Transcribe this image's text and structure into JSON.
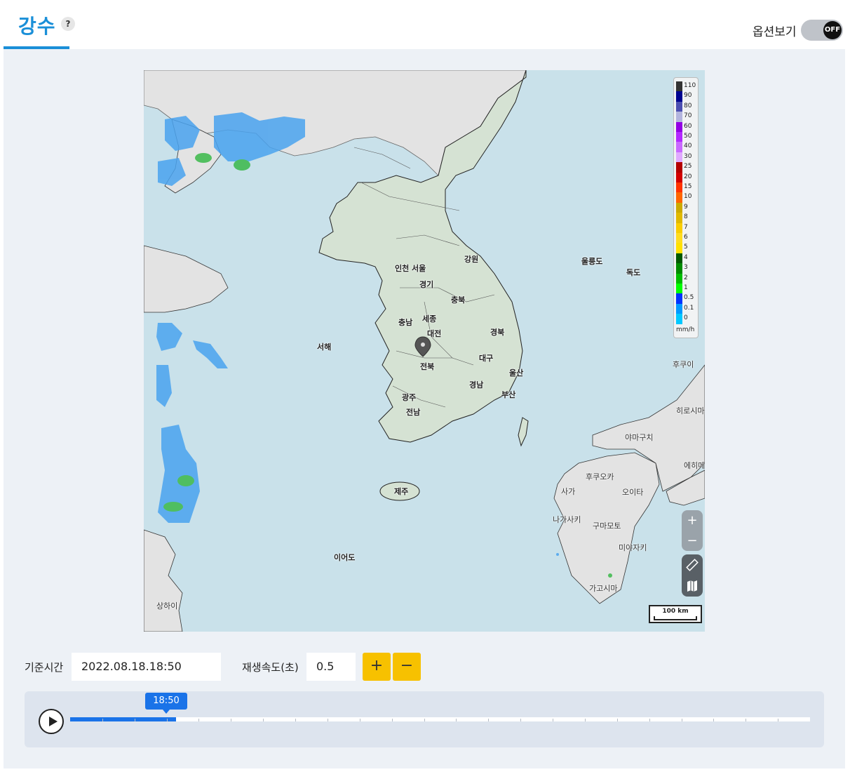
{
  "header": {
    "title": "강수",
    "help_symbol": "?",
    "option_label": "옵션보기",
    "toggle_state": "OFF"
  },
  "map": {
    "places": {
      "incheon": "인천",
      "seoul": "서울",
      "gyeonggi": "경기",
      "gangwon": "강원",
      "ulleungdo": "울릉도",
      "dokdo": "독도",
      "chungbuk": "충북",
      "sejong": "세종",
      "chungnam": "충남",
      "daejeon": "대전",
      "gyeongbuk": "경북",
      "seohae": "서해",
      "daegu": "대구",
      "jeonbuk": "전북",
      "ulsan": "울산",
      "gyeongnam": "경남",
      "busan": "부산",
      "gwangju": "광주",
      "jeonnam": "전남",
      "jeju": "제주",
      "ieodo": "이어도",
      "shanghai": "상하이",
      "hukuoka": "후쿠오카",
      "saga": "사가",
      "oita": "오이타",
      "nagasaki": "나가사키",
      "kumamoto": "구마모토",
      "miyazaki": "미야자키",
      "kagoshima": "가고시마",
      "yamaguchi": "야마구치",
      "hiroshima": "히로시마",
      "ehime": "에히메",
      "hukui": "후쿠이"
    },
    "legend": {
      "unit": "mm/h",
      "steps": [
        {
          "label": "110",
          "color": "#333333"
        },
        {
          "label": "90",
          "color": "#000390"
        },
        {
          "label": "80",
          "color": "#4c4eb1"
        },
        {
          "label": "70",
          "color": "#b3b4de"
        },
        {
          "label": "60",
          "color": "#9300e4"
        },
        {
          "label": "50",
          "color": "#b329ff"
        },
        {
          "label": "40",
          "color": "#c969ff"
        },
        {
          "label": "30",
          "color": "#e0a9ff"
        },
        {
          "label": "25",
          "color": "#b40000"
        },
        {
          "label": "20",
          "color": "#d20000"
        },
        {
          "label": "15",
          "color": "#ff3300"
        },
        {
          "label": "10",
          "color": "#ff6600"
        },
        {
          "label": "9",
          "color": "#ccaa00"
        },
        {
          "label": "8",
          "color": "#e0b900"
        },
        {
          "label": "7",
          "color": "#f9cd00"
        },
        {
          "label": "6",
          "color": "#ffdc1f"
        },
        {
          "label": "5",
          "color": "#ffe100"
        },
        {
          "label": "4",
          "color": "#005a00"
        },
        {
          "label": "3",
          "color": "#008c00"
        },
        {
          "label": "2",
          "color": "#00be00"
        },
        {
          "label": "1",
          "color": "#00ff00"
        },
        {
          "label": "0.5",
          "color": "#0033ff"
        },
        {
          "label": "0.1",
          "color": "#0099ff"
        },
        {
          "label": "0",
          "color": "#00c8ff"
        }
      ]
    },
    "zoom_in": "+",
    "zoom_out": "−",
    "scale_label": "100 km",
    "ruler_icon": "ruler-icon",
    "map_icon": "map-icon"
  },
  "controls": {
    "base_time_label": "기준시간",
    "base_time_value": "2022.08.18.18:50",
    "speed_label": "재생속도(초)",
    "speed_value": "0.5",
    "plus": "+",
    "minus": "−"
  },
  "timeline": {
    "current": "18:50",
    "progress_fraction": 0.143,
    "tick_count": 23
  },
  "colors": {
    "accent": "#1a8fd8",
    "timeline_blue": "#1a73e8",
    "button_yellow": "#f7c100"
  }
}
